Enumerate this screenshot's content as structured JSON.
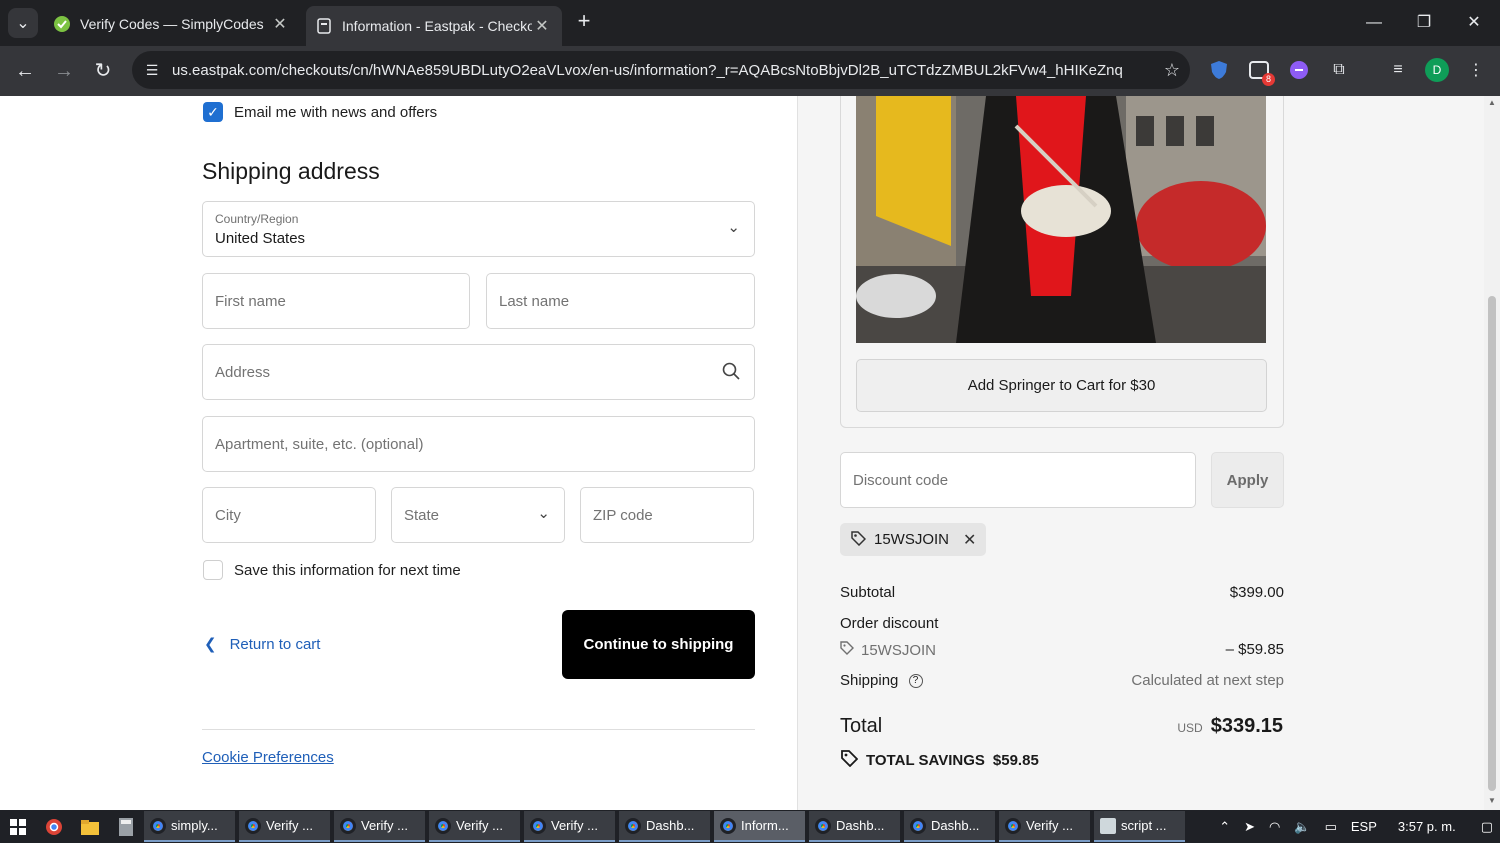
{
  "browser": {
    "tabs": [
      {
        "title": "Verify Codes — SimplyCodes",
        "active": false
      },
      {
        "title": "Information - Eastpak - Checkout",
        "active": true
      }
    ],
    "url": "us.eastpak.com/checkouts/cn/hWNAe859UBDLutyO2eaVLvox/en-us/information?_r=AQABcsNtoBbjvDl2B_uTCTdzZMBUL2kFVw4_hHIKeZnq",
    "extension_badge": "8",
    "profile_initial": "D"
  },
  "form": {
    "email_opt_in_label": "Email me with news and offers",
    "shipping_heading": "Shipping address",
    "country_label": "Country/Region",
    "country_value": "United States",
    "first_name_placeholder": "First name",
    "last_name_placeholder": "Last name",
    "address_placeholder": "Address",
    "apartment_placeholder": "Apartment, suite, etc. (optional)",
    "city_placeholder": "City",
    "state_placeholder": "State",
    "zip_placeholder": "ZIP code",
    "save_info_label": "Save this information for next time",
    "return_label": "Return to cart",
    "continue_label": "Continue to shipping",
    "cookie_label": "Cookie Preferences"
  },
  "summary": {
    "upsell_button": "Add Springer to Cart for $30",
    "discount_placeholder": "Discount code",
    "apply_label": "Apply",
    "applied_code": "15WSJOIN",
    "subtotal_label": "Subtotal",
    "subtotal_value": "$399.00",
    "order_discount_label": "Order discount",
    "discount_code": "15WSJOIN",
    "discount_value": "– $59.85",
    "shipping_label": "Shipping",
    "shipping_value": "Calculated at next step",
    "total_label": "Total",
    "total_currency": "USD",
    "total_value": "$339.15",
    "savings_label": "TOTAL SAVINGS",
    "savings_value": "$59.85"
  },
  "taskbar": {
    "apps": [
      "simply...",
      "Verify ...",
      "Verify ...",
      "Verify ...",
      "Verify ...",
      "Dashb...",
      "Inform...",
      "Dashb...",
      "Dashb...",
      "Verify ...",
      "script ..."
    ],
    "lang": "ESP",
    "time": "3:57 p. m."
  }
}
